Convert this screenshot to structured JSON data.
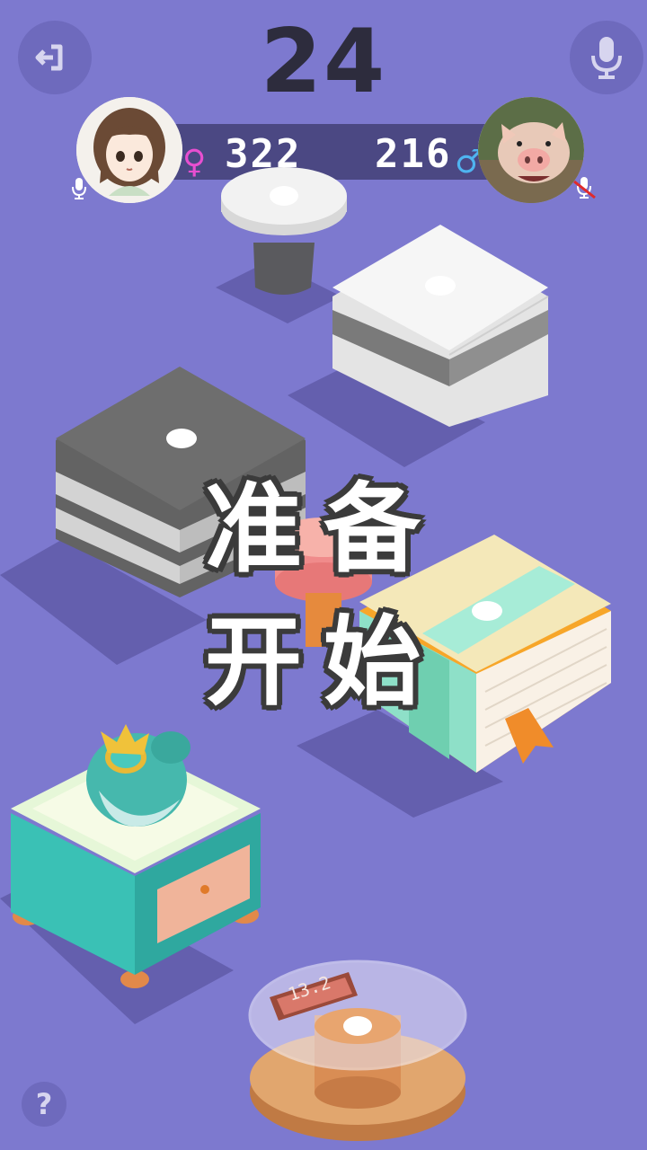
{
  "score": "24",
  "overlay": {
    "line1": "准备",
    "line2": "开始"
  },
  "player_left": {
    "score": "322",
    "gender_symbol": "♀",
    "gender_color": "#e84fd0",
    "mic_icon": "mic-icon"
  },
  "player_right": {
    "score": "216",
    "gender_symbol": "♂",
    "gender_color": "#4fb4f0",
    "mic_icon": "mic-muted-icon"
  },
  "buttons": {
    "exit_icon": "exit-icon",
    "mic_icon": "mic-icon",
    "help_label": "?"
  },
  "scale_display": "13.2",
  "colors": {
    "background": "#7d79cf",
    "score_bar": "#4b4883",
    "score_text": "#2d2c3d"
  }
}
